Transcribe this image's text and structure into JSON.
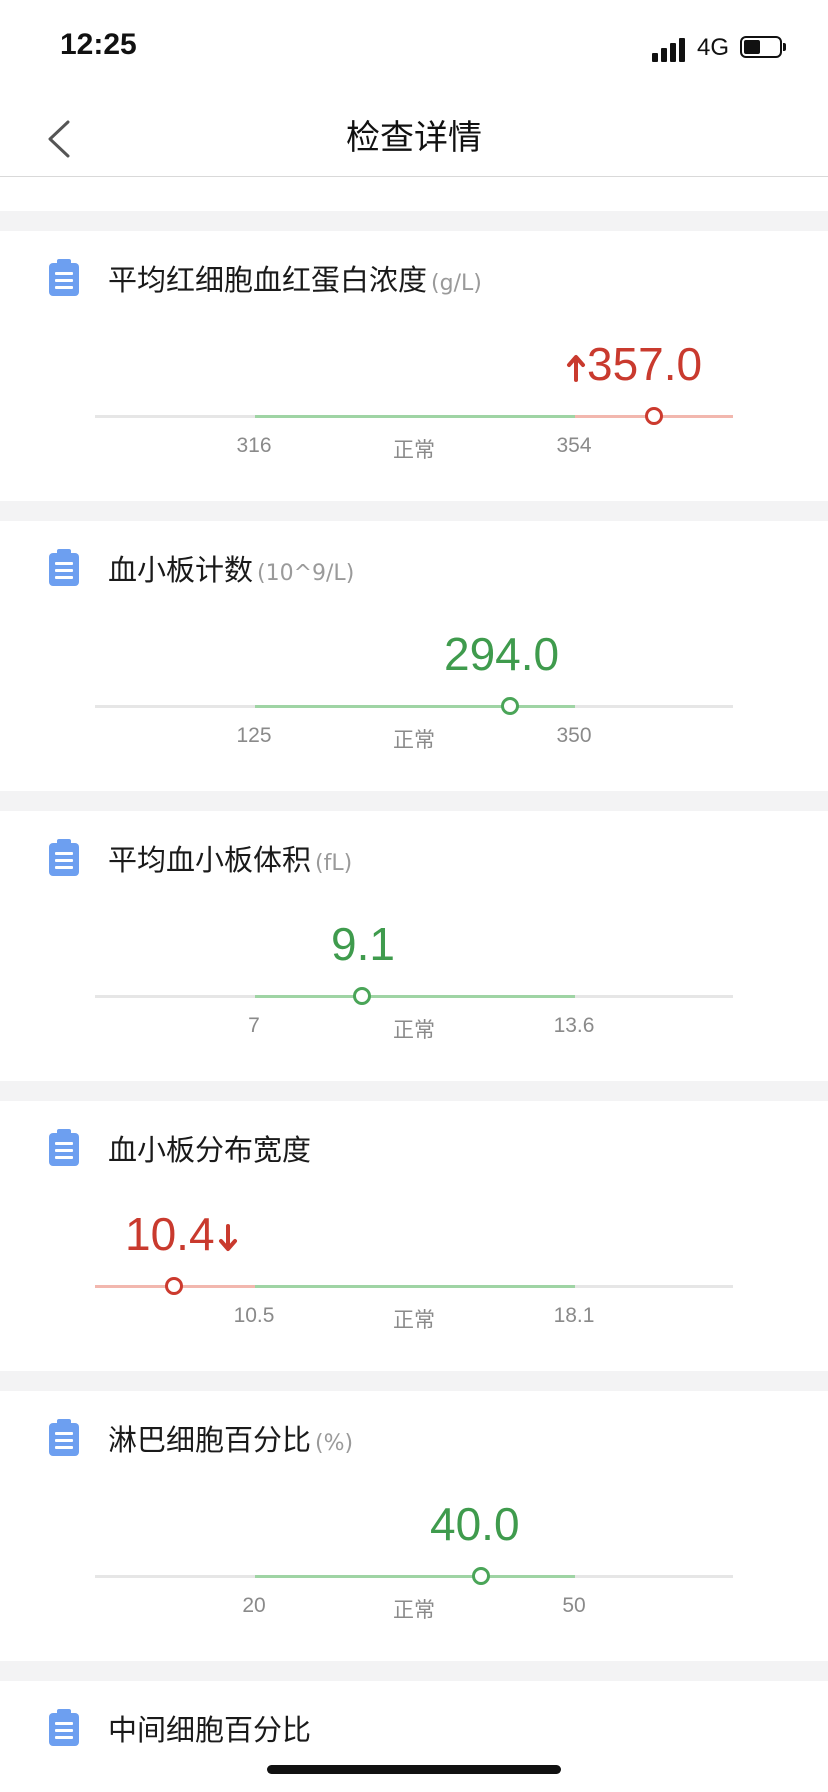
{
  "status_bar": {
    "time": "12:25",
    "network": "4G"
  },
  "nav": {
    "title": "检查详情",
    "back_icon": "chevron-left-icon"
  },
  "colors": {
    "normal": "#3f9b4d",
    "abnormal": "#c93a2e",
    "normal_track": "#9fd4a4",
    "abnormal_track": "#f2b7ae",
    "icon": "#6d9ff0"
  },
  "results": [
    {
      "name": "平均红细胞血红蛋白浓度",
      "unit": "(g/L)",
      "value": "357.0",
      "value_num": 357.0,
      "status": "high",
      "low": "316",
      "high": "354",
      "status_label": "正常"
    },
    {
      "name": "血小板计数",
      "unit": "(10^9/L)",
      "value": "294.0",
      "value_num": 294.0,
      "status": "normal",
      "low": "125",
      "high": "350",
      "status_label": "正常"
    },
    {
      "name": "平均血小板体积",
      "unit": "(fL)",
      "value": "9.1",
      "value_num": 9.1,
      "status": "normal",
      "low": "7",
      "high": "13.6",
      "status_label": "正常"
    },
    {
      "name": "血小板分布宽度",
      "unit": "",
      "value": "10.4",
      "value_num": 10.4,
      "status": "low",
      "low": "10.5",
      "high": "18.1",
      "status_label": "正常"
    },
    {
      "name": "淋巴细胞百分比",
      "unit": "(%)",
      "value": "40.0",
      "value_num": 40.0,
      "status": "normal",
      "low": "20",
      "high": "50",
      "status_label": "正常"
    },
    {
      "name": "中间细胞百分比",
      "unit": ""
    }
  ]
}
